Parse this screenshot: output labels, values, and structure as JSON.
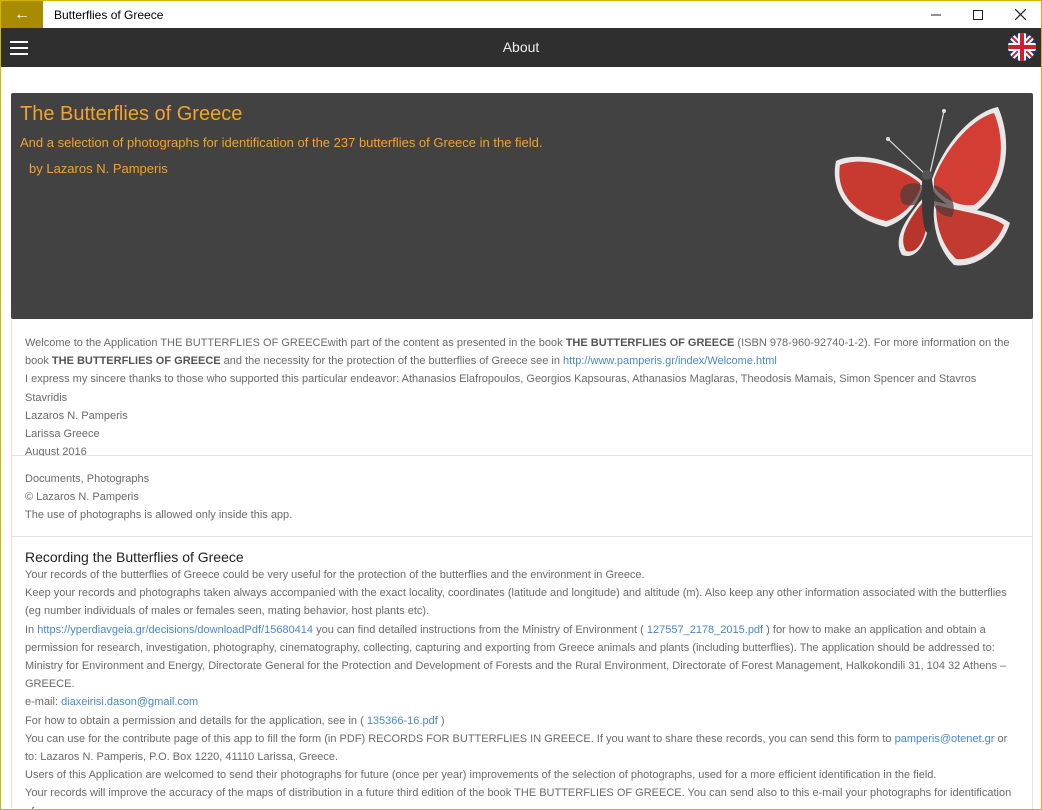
{
  "window": {
    "title": "Butterflies of Greece",
    "back_icon": "arrow-left-icon",
    "controls": [
      "minimize-icon",
      "maximize-icon",
      "close-icon"
    ]
  },
  "appbar": {
    "title": "About",
    "menu_icon": "hamburger-icon",
    "language_icon": "uk-flag-icon"
  },
  "hero": {
    "title": "The Butterflies of Greece",
    "subtitle": "And a selection of photographs for identification of the 237 butterflies of Greece in the field.",
    "author": "by Lazaros N. Pamperis",
    "background": "#424242",
    "accent": "#f3a22e"
  },
  "intro": {
    "p1_a": "Welcome to the Application THE BUTTERFLIES OF GREECEwith part of the content as presented in the book ",
    "p1_b": "THE BUTTERFLIES OF GREECE",
    "p1_c": " (ISBN 978-960-92740-1-2). For more information on the book ",
    "p1_d": "THE BUTTERFLIES OF GREECE",
    "p1_e": " and the necessity for the protection of the butterflies of Greece see in ",
    "p1_link": "http://www.pamperis.gr/index/Welcome.html",
    "thanks": "I express my sincere thanks to those who supported this particular endeavor: Athanasios Elafropoulos, Georgios Kapsouras, Athanasios Maglaras, Theodosis Mamais, Simon Spencer and Stavros Stavridis",
    "sign_name": "Lazaros N. Pamperis",
    "sign_place": "Larissa Greece",
    "sign_date": "August 2016"
  },
  "copyright": {
    "line1": "Documents, Photographs",
    "line2": "© Lazaros N. Pamperis",
    "line3": "The use of photographs is allowed only inside this app."
  },
  "recording": {
    "heading": "Recording the Butterflies of Greece",
    "p1": "Your records of the butterflies of Greece could be very useful for the protection of the butterflies and the environment in Greece.",
    "p2": "Keep your records and photographs taken always accompanied with the exact locality, coordinates (latitude and longitude) and altitude (m). Also keep any other information associated with the butterflies (eg number individuals of males or females seen, mating behavior, host plants etc).",
    "p3_a": "In ",
    "p3_link1": "https://yperdiavgeia.gr/decisions/downloadPdf/15680414",
    "p3_b": " you can find detailed instructions from the Ministry of Environment ( ",
    "p3_link2": "127557_2178_2015.pdf",
    "p3_c": " ) for how to make an application and obtain a permission for research, investigation, photography, cinematography, collecting, capturing and exporting from Greece animals and plants (including butterflies). The application should be addressed to: Ministry for Environment and Energy, Directorate General for the Protection and Development of Forests and the Rural Environment, Directorate of Forest Management, Halkokondili 31, 104 32 Athens – GREECE.",
    "email_label": "e-mail: ",
    "email": "diaxeirisi.dason@gmail.com",
    "p4_a": "For how to obtain a permission and details for the application, see in ( ",
    "p4_link": "135366-16.pdf",
    "p4_b": " )",
    "p5_a": "You can use for the contribute page of this app to fill the form (in PDF) RECORDS FOR BUTTERFLIES IN GREECE. If you want to share these records, you can send this form to ",
    "p5_link": "pamperis@otenet.gr",
    "p5_b": " or to: Lazaros N. Pamperis, P.O. Box 1220, 41110 Larissa, Greece.",
    "p6": "Users of this Application are welcomed to send their photographs for future (once per year) improvements of the selection of photographs, used for a more efficient identification in the field.",
    "p7": "Your records will improve the accuracy of the maps of distribution in a future third edition of the book THE BUTTERFLIES OF GREECE. You can send also to this e-mail your photographs for identification of"
  }
}
